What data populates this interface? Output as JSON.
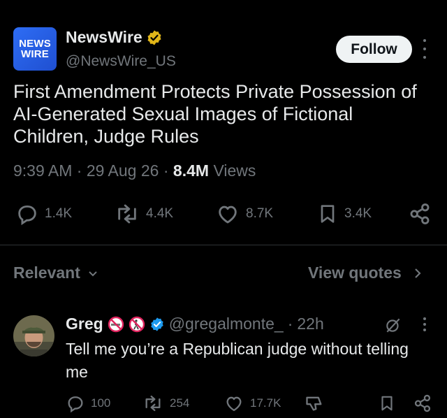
{
  "post": {
    "logo_line1": "NEWS",
    "logo_line2": "WIRE",
    "display_name": "NewsWire",
    "handle": "@NewsWire_US",
    "follow_label": "Follow",
    "text": "First Amendment Protects Private Possession of AI-Generated Sexual Images of Fictional Children, Judge Rules",
    "time": "9:39 AM",
    "date": "29 Aug 26",
    "views_count": "8.4M",
    "views_label": "Views",
    "replies": "1.4K",
    "reposts": "4.4K",
    "likes": "8.7K",
    "bookmarks": "3.4K",
    "verified_color": "#e2b719"
  },
  "filters": {
    "sort_label": "Relevant",
    "view_quotes_label": "View quotes"
  },
  "reply": {
    "name": "Greg",
    "handle": "@gregalmonte_",
    "time_ago": "22h",
    "text": "Tell me you’re a Republican judge without telling me",
    "replies": "100",
    "reposts": "254",
    "likes": "17.7K",
    "verified_color": "#1d9bf0",
    "badge_icons": [
      "no-smoking-emoji",
      "no-littering-emoji"
    ]
  },
  "colors": {
    "background": "#000000",
    "primary_text": "#e7e9ea",
    "secondary_text": "#71767b",
    "divider": "#2f3336"
  }
}
